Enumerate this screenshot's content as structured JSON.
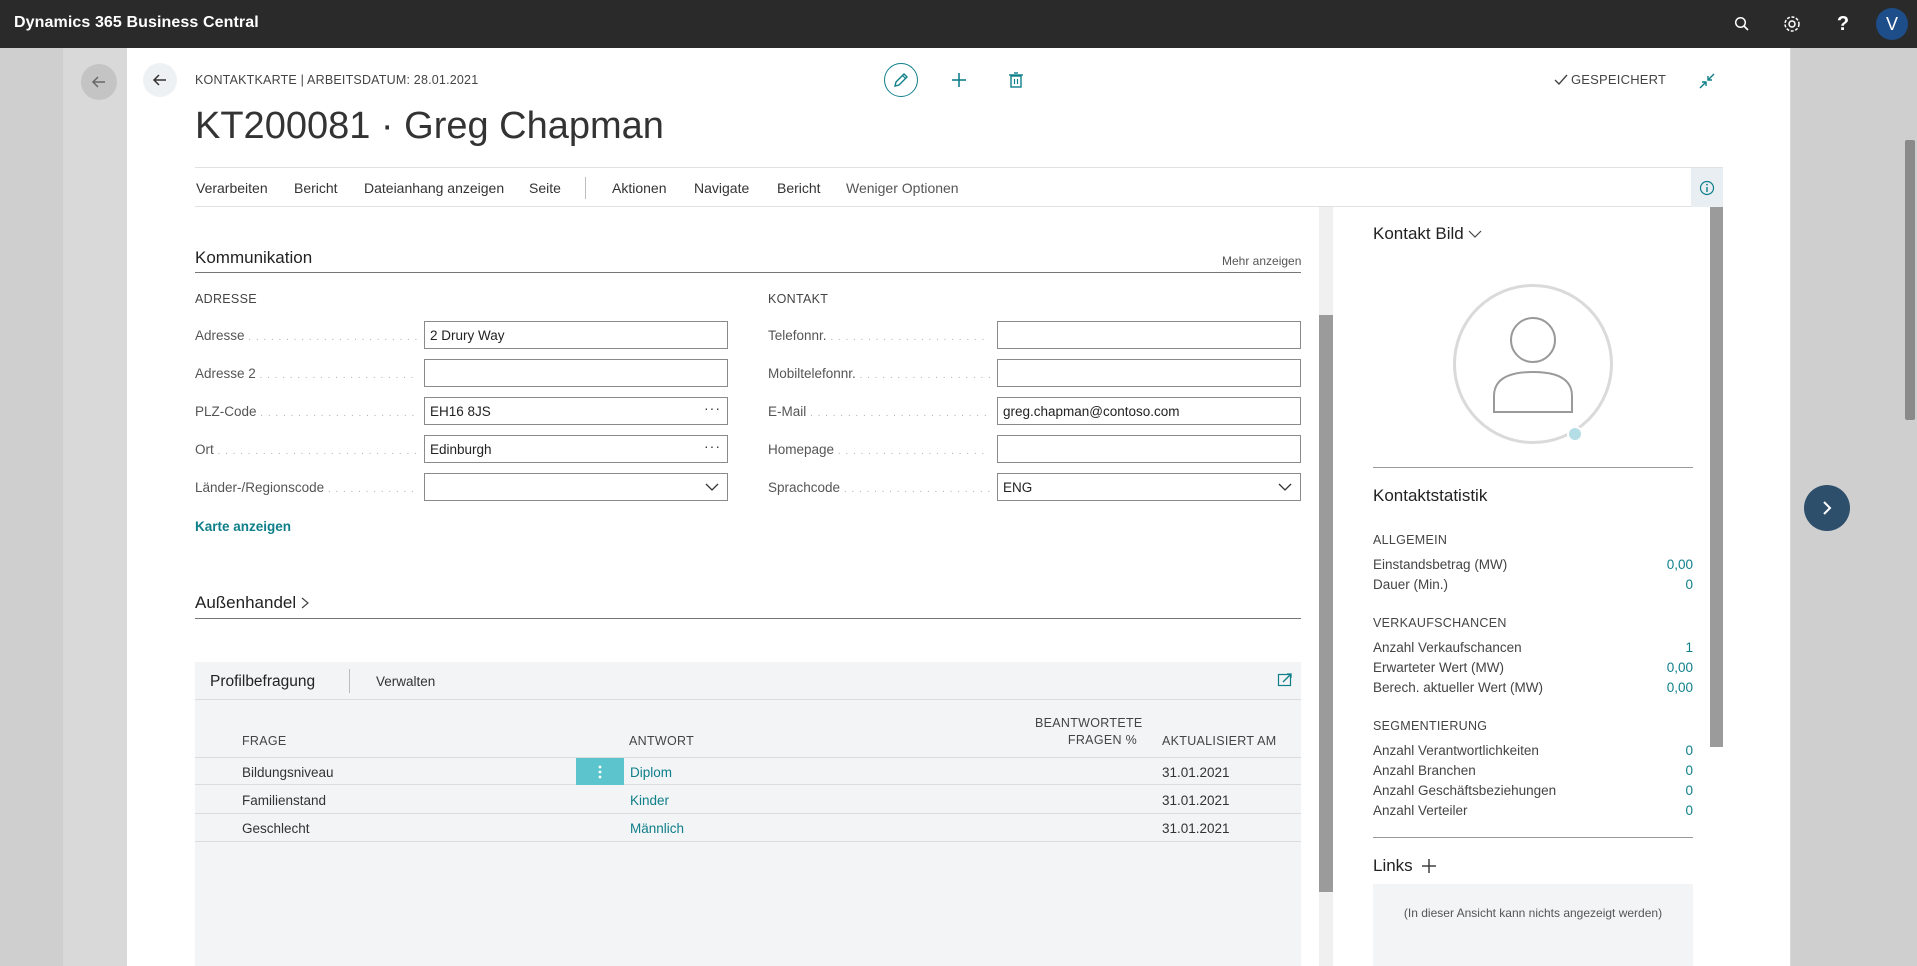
{
  "app": {
    "title": "Dynamics 365 Business Central",
    "user_initial": "V"
  },
  "header": {
    "caption": "KONTAKTKARTE | ARBEITSDATUM: 28.01.2021",
    "title": "KT200081 · Greg Chapman",
    "saved_label": "GESPEICHERT"
  },
  "actions": [
    "Verarbeiten",
    "Bericht",
    "Dateianhang anzeigen",
    "Seite",
    "Aktionen",
    "Navigate",
    "Bericht",
    "Weniger Optionen"
  ],
  "kommunikation": {
    "title": "Kommunikation",
    "more_link": "Mehr anzeigen",
    "address_group": "ADRESSE",
    "contact_group": "KONTAKT",
    "address_fields": [
      {
        "label": "Adresse",
        "value": "2 Drury Way"
      },
      {
        "label": "Adresse 2",
        "value": ""
      },
      {
        "label": "PLZ-Code",
        "value": "EH16 8JS"
      },
      {
        "label": "Ort",
        "value": "Edinburgh"
      },
      {
        "label": "Länder-/Regionscode",
        "value": ""
      }
    ],
    "contact_fields": [
      {
        "label": "Telefonnr.",
        "value": ""
      },
      {
        "label": "Mobiltelefonnr.",
        "value": ""
      },
      {
        "label": "E-Mail",
        "value": "greg.chapman@contoso.com"
      },
      {
        "label": "Homepage",
        "value": ""
      },
      {
        "label": "Sprachcode",
        "value": "ENG"
      }
    ],
    "map_link": "Karte anzeigen"
  },
  "aussenhandel": {
    "title": "Außenhandel"
  },
  "profile": {
    "tab_active": "Profilbefragung",
    "tab_manage": "Verwalten",
    "columns": {
      "question": "FRAGE",
      "answer": "ANTWORT",
      "answered_line1": "BEANTWORTETE",
      "answered_line2": "FRAGEN %",
      "updated": "AKTUALISIERT AM"
    },
    "rows": [
      {
        "question": "Bildungsniveau",
        "answer": "Diplom",
        "updated": "31.01.2021"
      },
      {
        "question": "Familienstand",
        "answer": "Kinder",
        "updated": "31.01.2021"
      },
      {
        "question": "Geschlecht",
        "answer": "Männlich",
        "updated": "31.01.2021"
      }
    ]
  },
  "factbox": {
    "photo_title": "Kontakt Bild",
    "stats_title": "Kontaktstatistik",
    "groups": [
      {
        "title": "ALLGEMEIN",
        "rows": [
          {
            "label": "Einstandsbetrag (MW)",
            "value": "0,00"
          },
          {
            "label": "Dauer (Min.)",
            "value": "0"
          }
        ]
      },
      {
        "title": "VERKAUFSCHANCEN",
        "rows": [
          {
            "label": "Anzahl Verkaufschancen",
            "value": "1"
          },
          {
            "label": "Erwarteter Wert (MW)",
            "value": "0,00"
          },
          {
            "label": "Berech. aktueller Wert (MW)",
            "value": "0,00"
          }
        ]
      },
      {
        "title": "SEGMENTIERUNG",
        "rows": [
          {
            "label": "Anzahl Verantwortlichkeiten",
            "value": "0"
          },
          {
            "label": "Anzahl Branchen",
            "value": "0"
          },
          {
            "label": "Anzahl Geschäftsbeziehungen",
            "value": "0"
          },
          {
            "label": "Anzahl Verteiler",
            "value": "0"
          }
        ]
      }
    ],
    "links_title": "Links",
    "links_empty": "(In dieser Ansicht kann nichts angezeigt werden)"
  },
  "colors": {
    "accent": "#0f7f8a",
    "topbar": "#2a2a2a",
    "avatar": "#1d4e89",
    "row_menu": "#5bc4cc"
  }
}
